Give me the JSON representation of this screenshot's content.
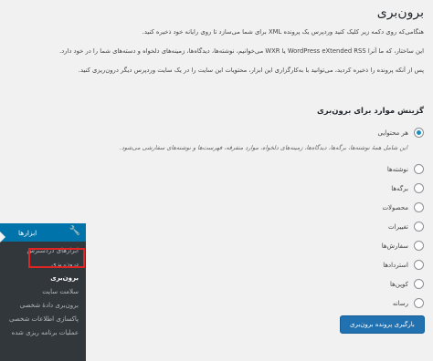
{
  "page": {
    "title": "برون‌بری",
    "intro": [
      "هنگامی‌که روی دکمه زیر کلیک کنید وردپرس یک پرونده XML برای شما می‌سازد تا روی رایانه خود ذخیره کنید.",
      "این ساختار، که ما آنرا WordPress eXtended RSS یا WXR می‌خوانیم، نوشته‌ها، دیدگاه‌ها، زمینه‌های دلخواه و دسته‌های شما را در خود دارد.",
      "پس از آنکه پرونده را ذخیره کردید، می‌توانید با به‌کارگزاری این ابزار، محتویات این سایت را در یک سایت وردپرس دیگر درون‌ریزی کنید."
    ],
    "choose_heading": "گزینش موارد برای برون‌بری",
    "all_content_label": "هر محتوایی",
    "all_content_desc": "این شامل همهٔ نوشته‌ها، برگه‌ها، دیدگاه‌ها، زمینه‌های دلخواه، موارد متفرقه، فهرست‌ها و نوشته‌های سفارشی می‌شود.",
    "options": [
      "نوشته‌ها",
      "برگه‌ها",
      "محصولات",
      "تغییرات",
      "سفارش‌ها",
      "استردادها",
      "کوپن‌ها",
      "رسانه"
    ],
    "download_button": "بارگیری پرونده برون‌بری"
  },
  "sidebar": {
    "menu_title": "ابزارها",
    "items": [
      "ابزارهای دردسترس",
      "درون‌ریزی",
      "برون‌بری",
      "سلامت سایت",
      "برون‌بری دادهٔ شخصی",
      "پاکسازی اطلاعات شخصی",
      "عملیات برنامه ریزی شده"
    ],
    "active_index": 2
  },
  "colors": {
    "accent": "#0073aa",
    "button": "#2271b1",
    "highlight": "#e02424",
    "sidebar_bg": "#32373c"
  },
  "icons": {
    "menu": "wrench-icon"
  }
}
